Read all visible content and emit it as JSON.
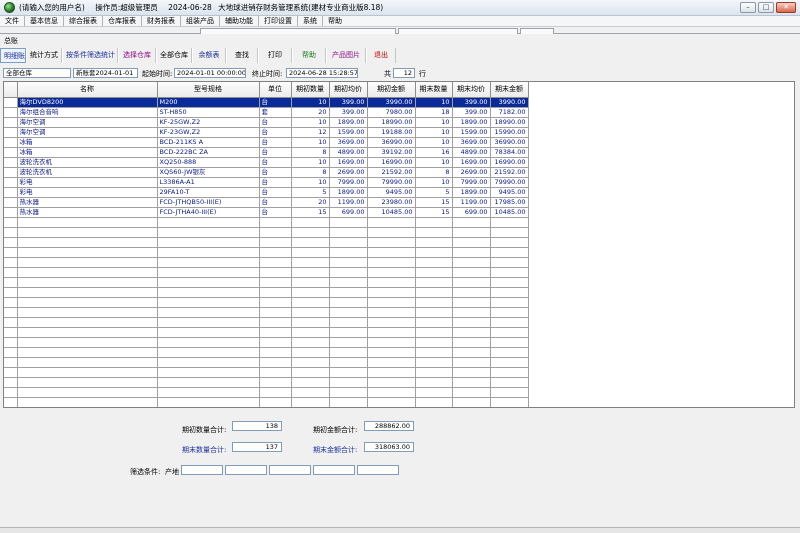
{
  "window": {
    "title_user": "(请输入您的用户名)",
    "title_operator": "操作员:超级管理员",
    "title_date": "2024-06-28",
    "title_app": "大地球进销存财务管理系统(建材专业商业版8.18)",
    "min_label": "–",
    "max_label": "□",
    "close_label": "✕"
  },
  "menu": [
    "文件",
    "基本信息",
    "综合报表",
    "仓库报表",
    "财务报表",
    "组装产品",
    "辅助功能",
    "打印设置",
    "系统",
    "帮助"
  ],
  "section_label": "总账",
  "toolbar": {
    "buttons": [
      {
        "label": "明细账",
        "color": "#1b2ea0"
      },
      {
        "label": "统计方式",
        "color": "#000000"
      },
      {
        "label": "按条件筛选统计",
        "color": "#1b2ea0"
      },
      {
        "label": "选择仓库",
        "color": "#8a0a8a"
      },
      {
        "label": "全部仓库",
        "color": "#000000"
      },
      {
        "label": "余额表",
        "color": "#1b2ea0"
      },
      {
        "label": "查找",
        "color": "#000000"
      },
      {
        "label": "打印",
        "color": "#000000"
      },
      {
        "label": "帮助",
        "color": "#1a7a1a"
      },
      {
        "label": "产品图片",
        "color": "#8a0a8a"
      },
      {
        "label": "退出",
        "color": "#c00000"
      }
    ]
  },
  "filters": {
    "warehouse": "全部仓库",
    "period_start": "新账套2024-01-01",
    "start_label": "起始时间:",
    "start_time": "2024-01-01 00:00:00",
    "end_label": "终止时间:",
    "end_time": "2024-06-28 15:28:57",
    "total_label": "共",
    "total_count": "12",
    "row_unit": "行"
  },
  "table": {
    "columns": [
      "名称",
      "型号规格",
      "单位",
      "期初数量",
      "期初均价",
      "期初金额",
      "期末数量",
      "期末均价",
      "期末金额"
    ],
    "rows": [
      [
        "海尔DVD8200",
        "M200",
        "台",
        "10",
        "399.00",
        "3990.00",
        "10",
        "399.00",
        "3990.00"
      ],
      [
        "海尔组合音响",
        "ST-H850",
        "套",
        "20",
        "399.00",
        "7980.00",
        "18",
        "399.00",
        "7182.00"
      ],
      [
        "海尔空调",
        "KF-25GW,Z2",
        "台",
        "10",
        "1899.00",
        "18990.00",
        "10",
        "1899.00",
        "18990.00"
      ],
      [
        "海尔空调",
        "KF-23GW,Z2",
        "台",
        "12",
        "1599.00",
        "19188.00",
        "10",
        "1599.00",
        "15990.00"
      ],
      [
        "冰箱",
        "BCD-211KS A",
        "台",
        "10",
        "3699.00",
        "36990.00",
        "10",
        "3699.00",
        "36990.00"
      ],
      [
        "冰箱",
        "BCD-222BC ZA",
        "台",
        "8",
        "4899.00",
        "39192.00",
        "16",
        "4899.00",
        "78384.00"
      ],
      [
        "波轮洗衣机",
        "XQ250-888",
        "台",
        "10",
        "1699.00",
        "16990.00",
        "10",
        "1699.00",
        "16990.00"
      ],
      [
        "波轮洗衣机",
        "XQS60-JW银灰",
        "台",
        "8",
        "2699.00",
        "21592.00",
        "8",
        "2699.00",
        "21592.00"
      ],
      [
        "彩电",
        "L3386A-A1",
        "台",
        "10",
        "7999.00",
        "79990.00",
        "10",
        "7999.00",
        "79990.00"
      ],
      [
        "彩电",
        "29FA10-T",
        "台",
        "5",
        "1899.00",
        "9495.00",
        "5",
        "1899.00",
        "9495.00"
      ],
      [
        "热水器",
        "FCD-JTHQB50-III(E)",
        "台",
        "20",
        "1199.00",
        "23980.00",
        "15",
        "1199.00",
        "17985.00"
      ],
      [
        "热水器",
        "FCD-JTHA40-III(E)",
        "台",
        "15",
        "699.00",
        "10485.00",
        "15",
        "699.00",
        "10485.00"
      ]
    ],
    "selected_row": 0,
    "empty_rows": 19
  },
  "summary": {
    "open_qty_label": "期初数量合计:",
    "open_qty": "138",
    "open_amt_label": "期初金额合计:",
    "open_amt": "288862.00",
    "close_qty_label": "期末数量合计:",
    "close_qty": "137",
    "close_amt_label": "期末金额合计:",
    "close_amt": "318063.00"
  },
  "condition": {
    "label": "筛选条件:",
    "field_label": "产地"
  }
}
